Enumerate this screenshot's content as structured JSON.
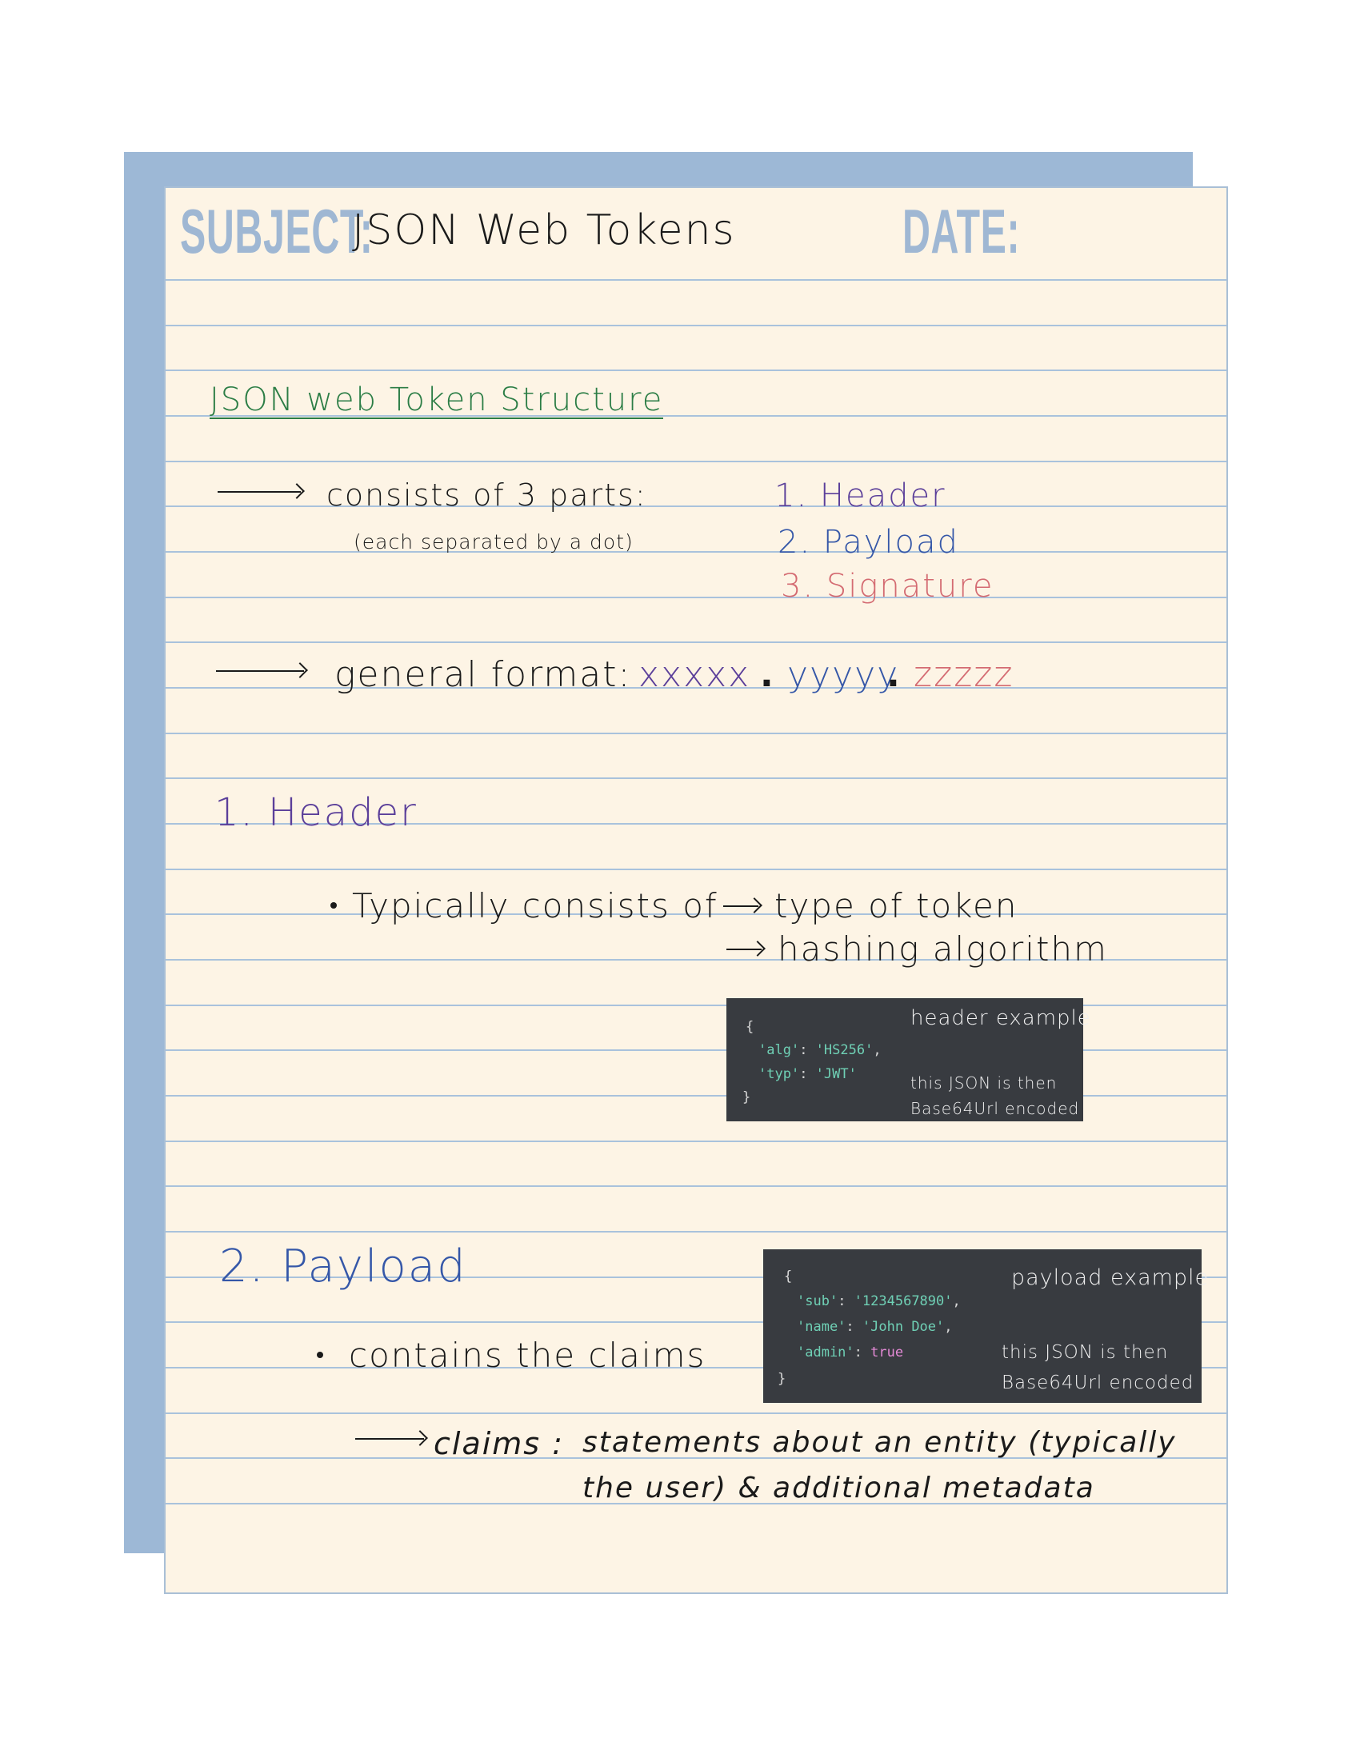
{
  "header": {
    "subject_label": "SUBJECT:",
    "subject_value": "JSON Web Tokens",
    "date_label": "DATE:",
    "date_value": ""
  },
  "section_main": {
    "title": "JSON web Token Structure",
    "consists_text": "consists of 3 parts:",
    "consists_note": "(each separated by a dot)",
    "parts": [
      "1. Header",
      "2. Payload",
      "3. Signature"
    ],
    "format_label": "general format:",
    "format_x": "xxxxx",
    "format_dot1": ".",
    "format_y": "yyyyy",
    "format_dot2": ".",
    "format_z": "zzzzz"
  },
  "section_header": {
    "title": "1. Header",
    "bullet_text": "Typically consists of",
    "items": [
      "type of token",
      "hashing algorithm"
    ],
    "example_title": "header example",
    "example_note_line1": "this JSON is then",
    "example_note_line2": "Base64Url encoded",
    "code": {
      "open": "{",
      "line1_key": "'alg'",
      "line1_sep": ": ",
      "line1_val": "'HS256'",
      "line1_end": ",",
      "line2_key": "'typ'",
      "line2_sep": ": ",
      "line2_val": "'JWT'",
      "close": "}"
    }
  },
  "section_payload": {
    "title": "2. Payload",
    "bullet_text": "contains the claims",
    "claims_label": "claims :",
    "claims_line1": "statements about an entity (typically",
    "claims_line2": "the user) & additional metadata",
    "example_title": "payload example",
    "example_note_line1": "this JSON is then",
    "example_note_line2": "Base64Url encoded",
    "code": {
      "open": "{",
      "line1_key": "'sub'",
      "line1_sep": ": ",
      "line1_val": "'1234567890'",
      "line1_end": ",",
      "line2_key": "'name'",
      "line2_sep": ": ",
      "line2_val": "'John Doe'",
      "line2_end": ",",
      "line3_key": "'admin'",
      "line3_sep": ": ",
      "line3_val": "true",
      "close": "}"
    }
  },
  "colors": {
    "paper": "#fdf4e5",
    "back_sheet": "#9db8d6",
    "rule_lines": "#a9c2dc",
    "label_blue": "#9fb7d3",
    "green": "#2b7d45",
    "purple": "#5b3f9a",
    "blue": "#3557a8",
    "red": "#d46b72",
    "code_bg": "#383b40"
  }
}
